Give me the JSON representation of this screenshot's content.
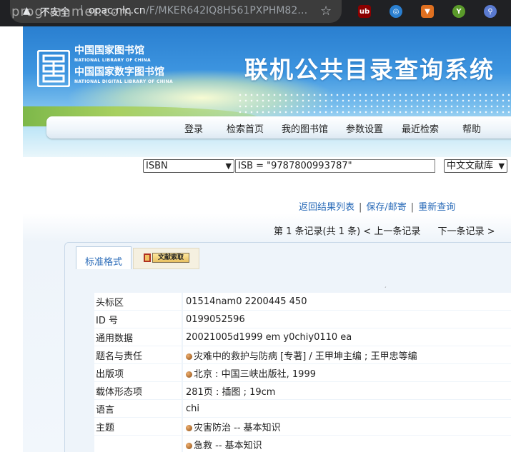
{
  "browser": {
    "insecure_label": "不安全",
    "url_host": "opac.nlc.cn",
    "url_path": "/F/MKER642IQ8H561PXPHM82…",
    "watermark": "programmer.com"
  },
  "header": {
    "logo_cn_1": "中国国家图书馆",
    "logo_en_1": "NATIONAL LIBRARY OF CHINA",
    "logo_cn_2": "中国国家数字图书馆",
    "logo_en_2": "NATIONAL DIGITAL LIBRARY OF CHINA",
    "system_title": "联机公共目录查询系统"
  },
  "nav": [
    "登录",
    "检索首页",
    "我的图书馆",
    "参数设置",
    "最近检索",
    "帮助"
  ],
  "search": {
    "field_select": "ISBN",
    "query": "ISB = \"9787800993787\"",
    "database_select": "中文文献库"
  },
  "result_links": {
    "back": "返回结果列表",
    "save": "保存/邮寄",
    "new_search": "重新查询"
  },
  "record_nav": {
    "position": "第 1 条记录(共 1 条)",
    "prev": "< 上一条记录",
    "next": "下一条记录 >"
  },
  "tabs": {
    "standard": "标准格式",
    "request": "文献索取"
  },
  "record": [
    {
      "key": "头标区",
      "value": "01514nam0 2200445 450",
      "bullet": false
    },
    {
      "key": "ID 号",
      "value": "0199052596",
      "bullet": false
    },
    {
      "key": "通用数据",
      "value": "20021005d1999 em y0chiy0110 ea",
      "bullet": false
    },
    {
      "key": "题名与责任",
      "value": "灾难中的救护与防病 [专著] / 王甲坤主编 ; 王甲忠等编",
      "bullet": true
    },
    {
      "key": "出版项",
      "value": "北京 : 中国三峡出版社, 1999",
      "bullet": true
    },
    {
      "key": "载体形态项",
      "value": "281页 : 插图 ; 19cm",
      "bullet": false
    },
    {
      "key": "语言",
      "value": "chi",
      "bullet": false
    },
    {
      "key": "主题",
      "value": "灾害防治 -- 基本知识",
      "bullet": true
    },
    {
      "key": "",
      "value": "急救 -- 基本知识",
      "bullet": true
    }
  ]
}
